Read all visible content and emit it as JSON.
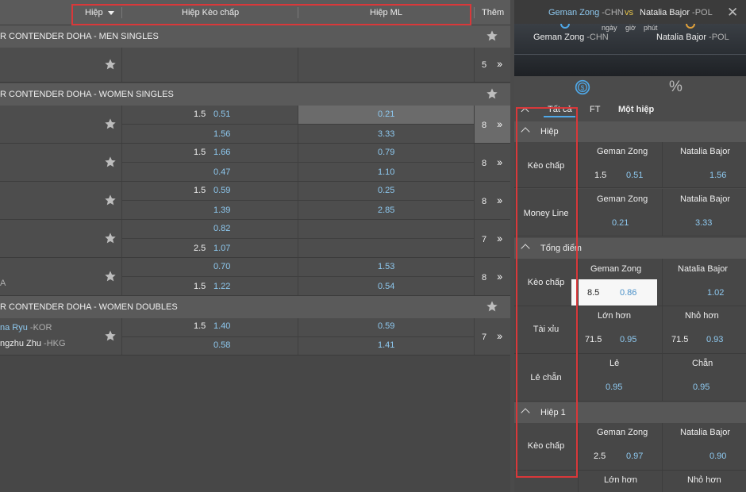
{
  "header": {
    "col1": "Hiệp",
    "col2": "Hiệp Kèo chấp",
    "col3": "Hiệp ML",
    "col4": "Thêm"
  },
  "leagues": {
    "men_singles": "R CONTENDER DOHA - MEN SINGLES",
    "women_singles": "R CONTENDER DOHA - WOMEN SINGLES",
    "women_doubles": "R CONTENDER DOHA - WOMEN DOUBLES"
  },
  "men_row": {
    "count": "5"
  },
  "ws": [
    {
      "h1": "1.5",
      "o1": "0.51",
      "h2": "",
      "o2": "1.56",
      "ml1": "0.21",
      "ml2": "3.33",
      "count": "8",
      "side": ""
    },
    {
      "h1": "1.5",
      "o1": "1.66",
      "h2": "",
      "o2": "0.47",
      "ml1": "0.79",
      "ml2": "1.10",
      "count": "8",
      "side": ""
    },
    {
      "h1": "1.5",
      "o1": "0.59",
      "h2": "",
      "o2": "1.39",
      "ml1": "0.25",
      "ml2": "2.85",
      "count": "8",
      "side": ""
    },
    {
      "h1": "",
      "o1": "0.82",
      "h2": "2.5",
      "o2": "1.07",
      "ml1": "",
      "ml2": "",
      "count": "7",
      "side": ""
    },
    {
      "h1": "",
      "o1": "0.70",
      "h2": "1.5",
      "o2": "1.22",
      "ml1": "1.53",
      "ml2": "0.54",
      "count": "8",
      "side": "A"
    }
  ],
  "wd": {
    "p1": "na Ryu",
    "c1": " -KOR",
    "p2": "ngzhu Zhu",
    "c2": " -HKG",
    "h1": "1.5",
    "o1": "1.40",
    "o2": "0.58",
    "ml1": "0.59",
    "ml2": "1.41",
    "count": "7"
  },
  "match": {
    "home": "Geman Zong",
    "home_cc": " -CHN",
    "vs": "vs",
    "away": "Natalia Bajor",
    "away_cc": " -POL",
    "t1": "ngày",
    "t2": "giờ",
    "t3": "phút"
  },
  "tabs": {
    "all": "Tất cả",
    "ft": "FT",
    "one": "Một hiệp",
    "percent": "%"
  },
  "sections": {
    "hiep": "Hiệp",
    "tong": "Tổng điểm",
    "hiep1": "Hiệp 1"
  },
  "markets": {
    "keo1": {
      "label": "Kèo chấp",
      "a": "Geman Zong",
      "b": "Natalia Bajor",
      "ah": "1.5",
      "ao": "0.51",
      "bo": "1.56"
    },
    "ml": {
      "label": "Money Line",
      "a": "Geman Zong",
      "b": "Natalia Bajor",
      "ao": "0.21",
      "bo": "3.33"
    },
    "keo2": {
      "label": "Kèo chấp",
      "a": "Geman Zong",
      "b": "Natalia Bajor",
      "ah": "8.5",
      "ao": "0.86",
      "bo": "1.02"
    },
    "taixiu": {
      "label": "Tài xỉu",
      "a": "Lớn hơn",
      "b": "Nhỏ hơn",
      "ah": "71.5",
      "ao": "0.95",
      "bh": "71.5",
      "bo": "0.93"
    },
    "lechan": {
      "label": "Lẻ chẵn",
      "a": "Lẻ",
      "b": "Chẵn",
      "ao": "0.95",
      "bo": "0.95"
    },
    "keo3": {
      "label": "Kèo chấp",
      "a": "Geman Zong",
      "b": "Natalia Bajor",
      "ah": "2.5",
      "ao": "0.97",
      "bo": "0.90"
    },
    "taixiu2": {
      "a": "Lớn hơn",
      "b": "Nhỏ hơn"
    }
  },
  "colors": {
    "accent": "#8ec9f0",
    "highlight": "#d9383a",
    "tab_underline": "#4fa8e8"
  }
}
